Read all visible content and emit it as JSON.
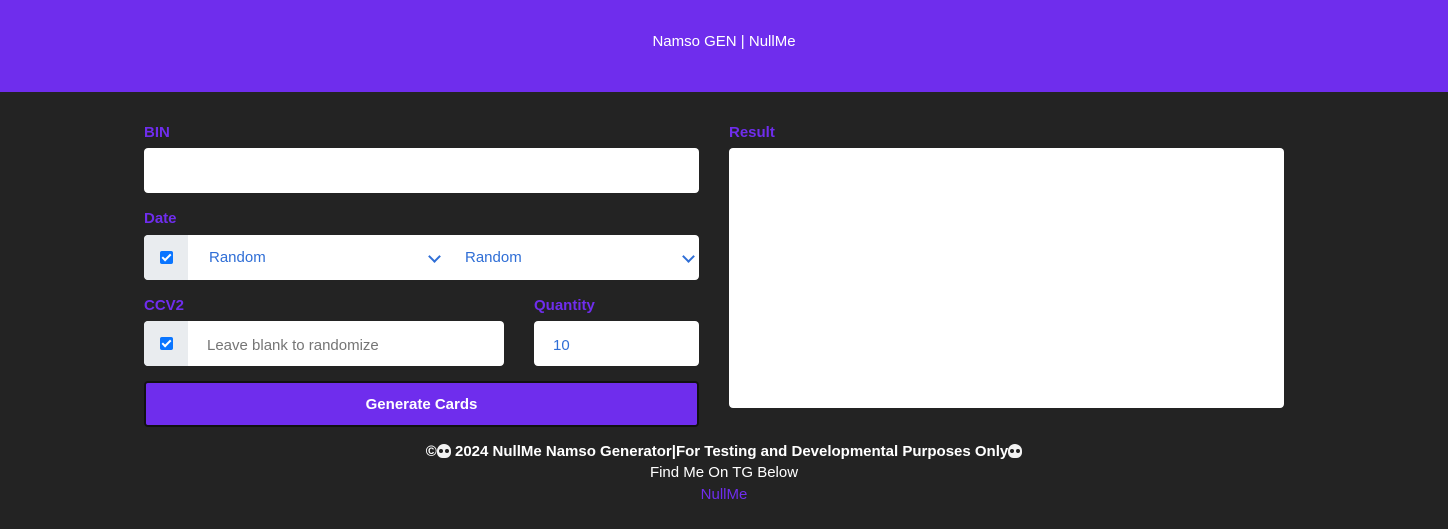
{
  "header": {
    "title": "Namso GEN | NullMe"
  },
  "form": {
    "bin_label": "BIN",
    "bin_value": "",
    "date_label": "Date",
    "date_month_selected": "Random",
    "date_year_selected": "Random",
    "ccv_label": "CCV2",
    "ccv_placeholder": "Leave blank to randomize",
    "quantity_label": "Quantity",
    "quantity_value": "10",
    "generate_label": "Generate Cards"
  },
  "result": {
    "label": "Result",
    "value": ""
  },
  "footer": {
    "copyright_symbol": "©",
    "copyright_text": " 2024 NullMe Namso Generator|For Testing and Developmental Purposes Only",
    "find_me": "Find Me On TG Below",
    "link_text": "NullMe"
  },
  "colors": {
    "accent": "#6f2ded",
    "background": "#232323",
    "select_text": "#2f6ed6",
    "checkbox": "#0a75ff"
  },
  "icons": {
    "date_checkbox": "checkbox-checked-icon",
    "ccv_checkbox": "checkbox-checked-icon",
    "select_arrow": "chevron-down-icon",
    "footer_emoji": "skull-icon"
  }
}
